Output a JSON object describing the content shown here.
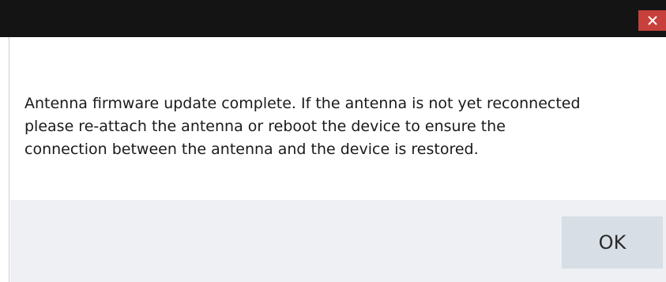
{
  "dialog": {
    "message": "Antenna firmware update complete. If the antenna is not yet reconnected\nplease re-attach the antenna or reboot the device to ensure the\nconnection between the antenna and the device is restored.",
    "ok_label": "OK",
    "close_icon": "close-icon"
  },
  "colors": {
    "titlebar": "#141414",
    "close_button": "#c8403b",
    "footer": "#eef0f3",
    "ok_button": "#d8dee5"
  }
}
